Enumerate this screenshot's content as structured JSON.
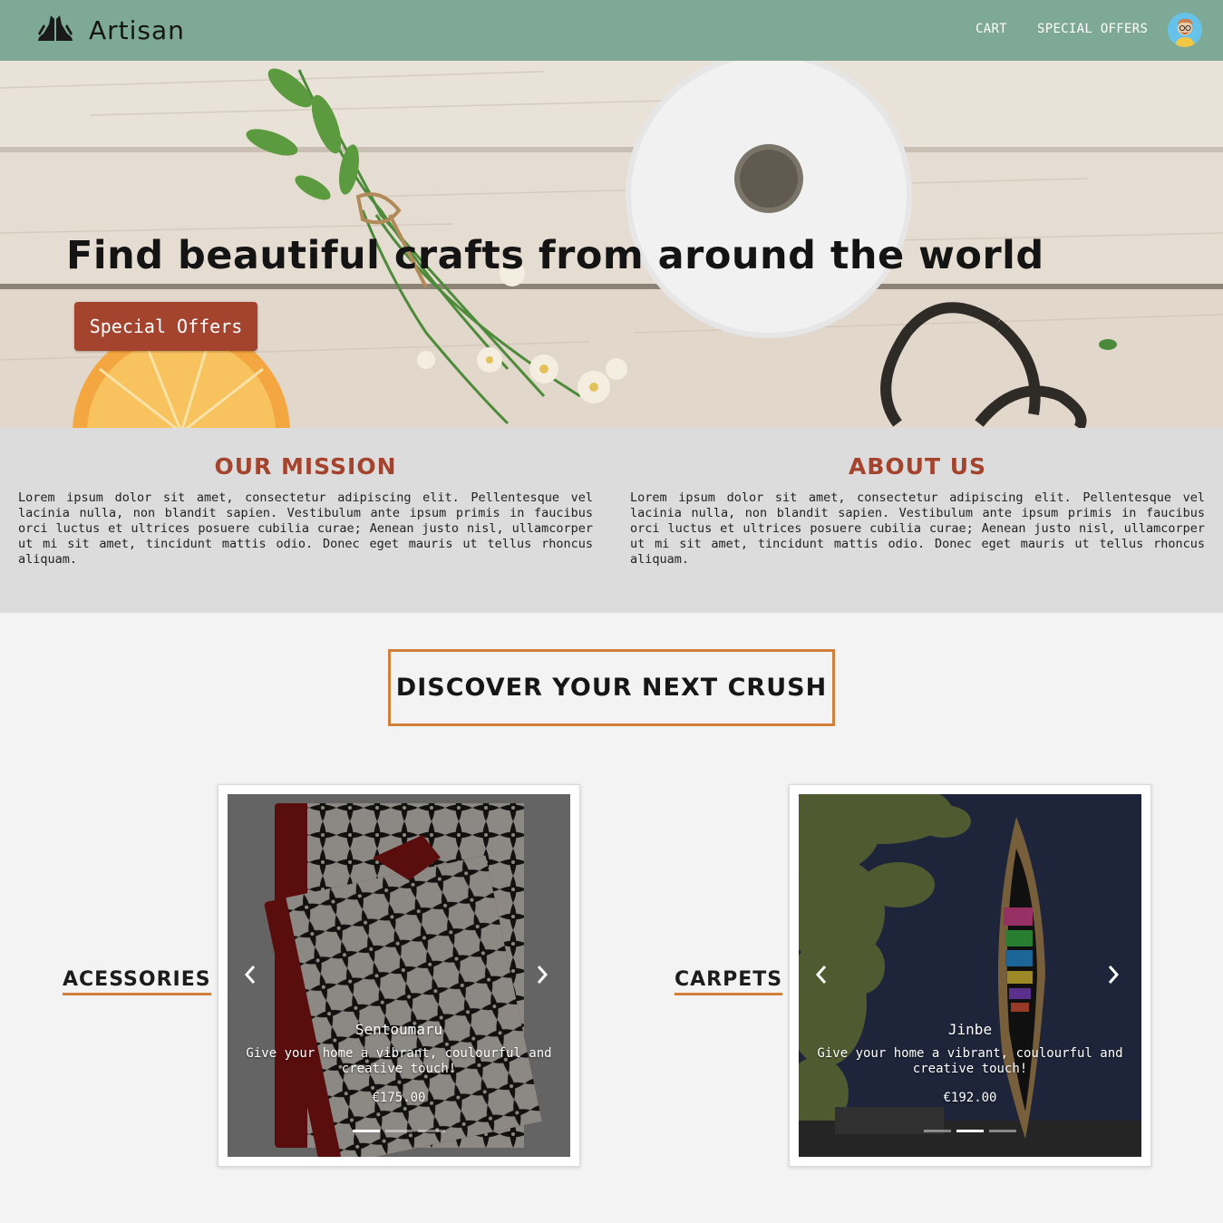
{
  "navbar": {
    "brand": "Artisan",
    "links": [
      "CART",
      "SPECIAL OFFERS"
    ],
    "avatar_icon": "avatar-icon",
    "background": "#7ea997"
  },
  "hero": {
    "title": "Find beautiful crafts from around the world",
    "button_label": "Special Offers",
    "button_color": "#a5442e"
  },
  "info": {
    "mission": {
      "title": "OUR MISSION",
      "text": "Lorem ipsum dolor sit amet, consectetur adipiscing elit. Pellentesque vel lacinia nulla, non blandit sapien. Vestibulum ante ipsum primis in faucibus orci luctus et ultrices posuere cubilia curae; Aenean justo nisl, ullamcorper ut mi sit amet, tincidunt mattis odio. Donec eget mauris ut tellus rhoncus aliquam."
    },
    "about": {
      "title": "ABOUT US",
      "text": "Lorem ipsum dolor sit amet, consectetur adipiscing elit. Pellentesque vel lacinia nulla, non blandit sapien. Vestibulum ante ipsum primis in faucibus orci luctus et ultrices posuere cubilia curae; Aenean justo nisl, ullamcorper ut mi sit amet, tincidunt mattis odio. Donec eget mauris ut tellus rhoncus aliquam."
    }
  },
  "discover": {
    "title": "DISCOVER YOUR NEXT CRUSH",
    "accent": "#d37f3c"
  },
  "categories": [
    {
      "label": "ACESSORIES",
      "product": {
        "name": "Sentoumaru",
        "description": "Give your home a vibrant, coulourful and creative touch!",
        "price": "€175.00",
        "active_slide": 1,
        "slide_count": 3
      }
    },
    {
      "label": "CARPETS",
      "product": {
        "name": "Jinbe",
        "description": "Give your home a vibrant, coulourful and creative touch!",
        "price": "€192.00",
        "active_slide": 2,
        "slide_count": 3
      }
    }
  ]
}
